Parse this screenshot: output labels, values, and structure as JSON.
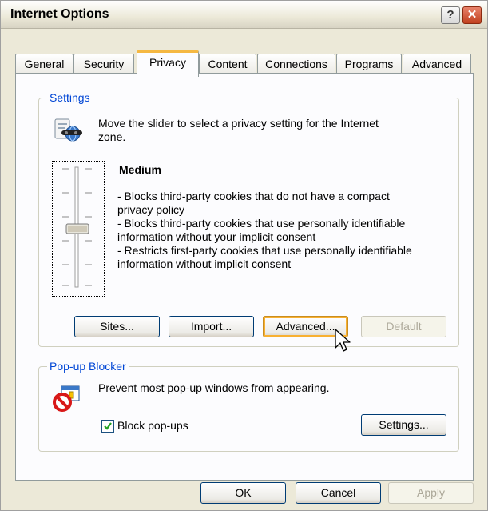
{
  "window": {
    "title": "Internet Options",
    "help_glyph": "?",
    "close_glyph": "✕"
  },
  "tabs": [
    {
      "label": "General",
      "active": false
    },
    {
      "label": "Security",
      "active": false
    },
    {
      "label": "Privacy",
      "active": true
    },
    {
      "label": "Content",
      "active": false
    },
    {
      "label": "Connections",
      "active": false
    },
    {
      "label": "Programs",
      "active": false
    },
    {
      "label": "Advanced",
      "active": false
    }
  ],
  "settings": {
    "legend": "Settings",
    "intro_line1": "Move the slider to select a privacy setting for the Internet",
    "intro_line2": "zone.",
    "level_title": "Medium",
    "desc_lines": [
      "- Blocks third-party cookies that do not have a compact",
      "privacy policy",
      "- Blocks third-party cookies that use personally identifiable",
      "information without your implicit consent",
      "- Restricts first-party cookies that use personally identifiable",
      "information without implicit consent"
    ],
    "slider_level": "Medium",
    "buttons": {
      "sites": "Sites...",
      "import": "Import...",
      "advanced": "Advanced...",
      "default": "Default"
    }
  },
  "popup": {
    "legend": "Pop-up Blocker",
    "description": "Prevent most pop-up windows from appearing.",
    "checkbox_label": "Block pop-ups",
    "checkbox_checked": true,
    "settings_button": "Settings..."
  },
  "footer": {
    "ok": "OK",
    "cancel": "Cancel",
    "apply": "Apply"
  },
  "colors": {
    "legend_text": "#0046d5",
    "active_tab_accent": "#f5b842",
    "hover_accent": "#f8b030"
  }
}
